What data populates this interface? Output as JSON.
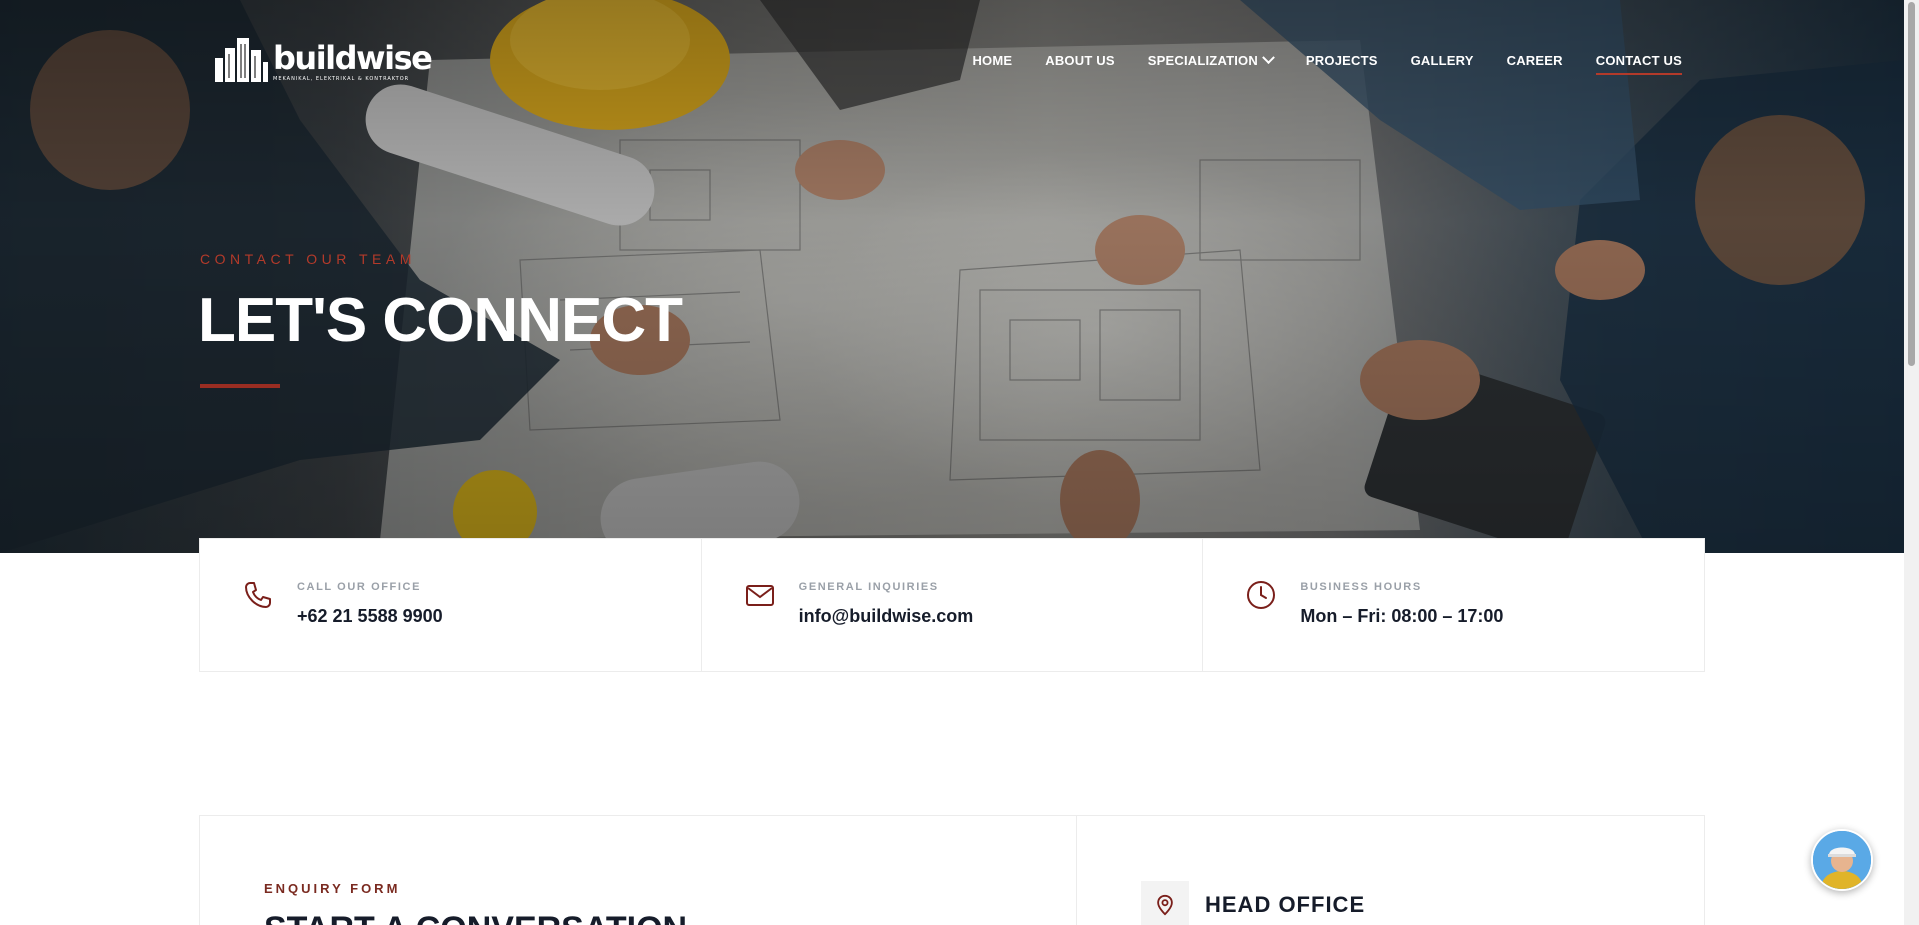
{
  "brand": {
    "name": "buildwise",
    "tagline": "MEKANIKAL, ELEKTRIKAL & KONTRAKTOR"
  },
  "nav": {
    "items": [
      {
        "label": "HOME"
      },
      {
        "label": "ABOUT US"
      },
      {
        "label": "SPECIALIZATION"
      },
      {
        "label": "PROJECTS"
      },
      {
        "label": "GALLERY"
      },
      {
        "label": "CAREER"
      },
      {
        "label": "CONTACT US"
      }
    ]
  },
  "hero": {
    "eyebrow": "CONTACT OUR TEAM",
    "title": "LET'S CONNECT"
  },
  "info": [
    {
      "icon": "phone-icon",
      "label": "CALL OUR OFFICE",
      "value": "+62 21 5588 9900"
    },
    {
      "icon": "mail-icon",
      "label": "GENERAL INQUIRIES",
      "value": "info@buildwise.com"
    },
    {
      "icon": "clock-icon",
      "label": "BUSINESS HOURS",
      "value": "Mon – Fri: 08:00 – 17:00"
    }
  ],
  "enquiry": {
    "label": "ENQUIRY FORM",
    "title": "START A CONVERSATION"
  },
  "office": {
    "title": "HEAD OFFICE"
  },
  "colors": {
    "accent": "#b33a2a",
    "dark": "#161c2a"
  }
}
